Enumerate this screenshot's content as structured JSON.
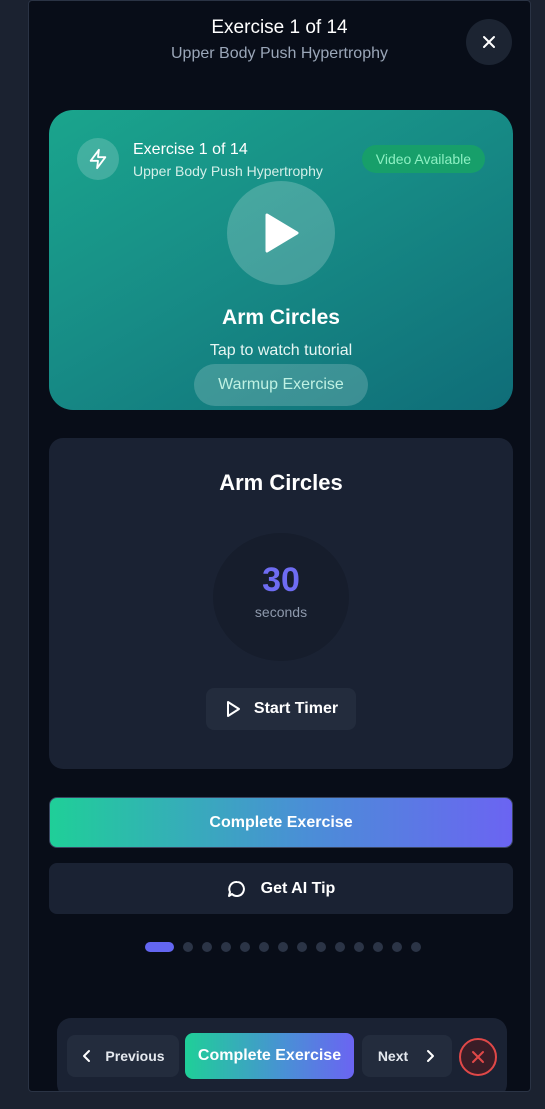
{
  "header": {
    "title": "Exercise 1 of 14",
    "subtitle": "Upper Body Push Hypertrophy",
    "close_icon": "close-icon"
  },
  "hero": {
    "counter": "Exercise 1 of 14",
    "workout": "Upper Body Push Hypertrophy",
    "video_badge": "Video Available",
    "exercise_name": "Arm Circles",
    "tap_hint": "Tap to watch tutorial",
    "tag": "Warmup Exercise",
    "icons": [
      "lightning-icon",
      "play-icon"
    ]
  },
  "timer_card": {
    "title": "Arm Circles",
    "value": "30",
    "unit": "seconds",
    "start_label": "Start Timer"
  },
  "actions": {
    "complete_label": "Complete Exercise",
    "ai_tip_label": "Get AI Tip"
  },
  "progress": {
    "total": 14,
    "current": 1
  },
  "bottom_nav": {
    "previous_label": "Previous",
    "complete_label": "Complete Exercise",
    "next_label": "Next"
  },
  "colors": {
    "accent": "#6366f1",
    "teal": "#1aa58d",
    "danger": "#e04848",
    "background": "#080d18"
  }
}
